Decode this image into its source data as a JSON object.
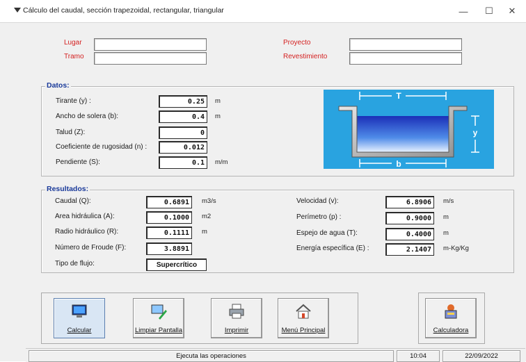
{
  "window": {
    "title": "Cálculo del caudal, sección trapezoidal, rectangular, triangular",
    "minimize_glyph": "—",
    "maximize_glyph": "☐",
    "close_glyph": "✕"
  },
  "header": {
    "lugar_label": "Lugar",
    "lugar_value": "",
    "tramo_label": "Tramo",
    "tramo_value": "",
    "proyecto_label": "Proyecto",
    "proyecto_value": "",
    "revestimiento_label": "Revestimiento",
    "revestimiento_value": ""
  },
  "datos": {
    "title": "Datos:",
    "fields": [
      {
        "label": "Tirante (y) :",
        "value": "0.25",
        "unit": "m"
      },
      {
        "label": "Ancho de solera (b):",
        "value": "0.4",
        "unit": "m"
      },
      {
        "label": "Talud (Z):",
        "value": "0",
        "unit": ""
      },
      {
        "label": "Coeficiente de rugosidad (n) :",
        "value": "0.012",
        "unit": ""
      },
      {
        "label": "Pendiente (S):",
        "value": "0.1",
        "unit": "m/m"
      }
    ]
  },
  "diagram": {
    "top_label": "T",
    "depth_label": "y",
    "bottom_label": "b",
    "bg_color": "#29a3e0",
    "water_color": "#1b2fb8"
  },
  "resultados": {
    "title": "Resultados:",
    "left": [
      {
        "label": "Caudal (Q):",
        "value": "0.6891",
        "unit": "m3/s"
      },
      {
        "label": "Area hidráulica (A):",
        "value": "0.1000",
        "unit": "m2"
      },
      {
        "label": "Radio hidráulico (R):",
        "value": "0.1111",
        "unit": "m"
      },
      {
        "label": "Número de Froude (F):",
        "value": "3.8891",
        "unit": ""
      }
    ],
    "flow_type_label": "Tipo de flujo:",
    "flow_type_value": "Supercrítico",
    "right": [
      {
        "label": "Velocidad (v):",
        "value": "6.8906",
        "unit": "m/s"
      },
      {
        "label": "Perímetro (p) :",
        "value": "0.9000",
        "unit": "m"
      },
      {
        "label": "Espejo de agua (T):",
        "value": "0.4000",
        "unit": "m"
      },
      {
        "label": "Energía específica (E) :",
        "value": "2.1407",
        "unit": "m-Kg/Kg"
      }
    ]
  },
  "toolbar": {
    "calcular": "Calcular",
    "limpiar": "Limpiar Pantalla",
    "imprimir": "Imprimir",
    "menu": "Menú Principal",
    "calculadora": "Calculadora"
  },
  "status": {
    "message": "Ejecuta las operaciones",
    "time": "10:04",
    "date": "22/09/2022"
  }
}
